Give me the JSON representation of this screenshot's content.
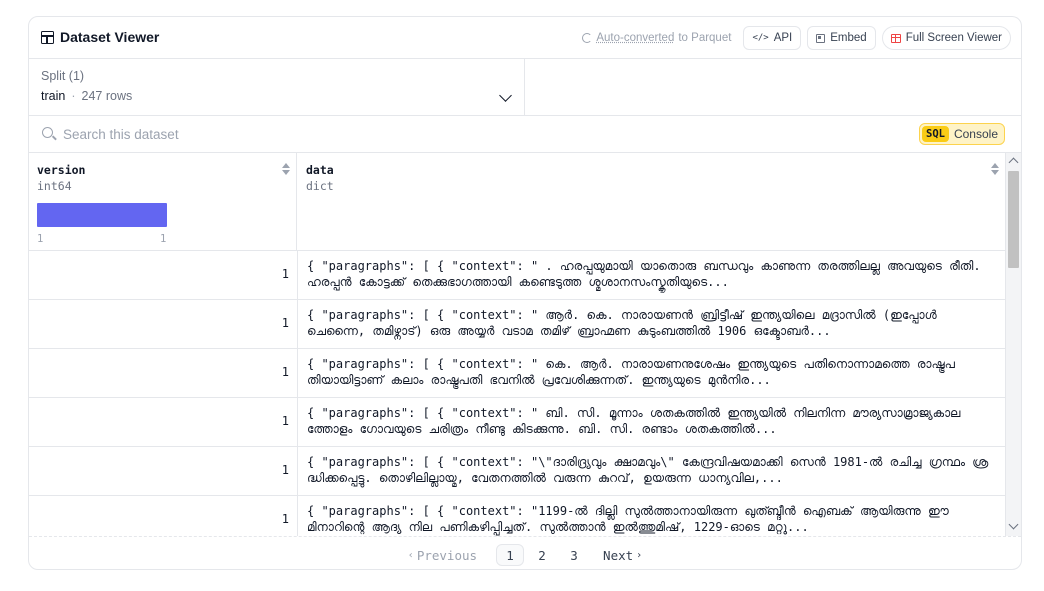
{
  "header": {
    "title": "Dataset Viewer",
    "auto_converted_link": "Auto-converted",
    "auto_converted_suffix": "to Parquet",
    "api_label": "API",
    "embed_label": "Embed",
    "full_screen_label": "Full Screen Viewer"
  },
  "split": {
    "label": "Split (1)",
    "name": "train",
    "separator": "·",
    "rows": "247 rows"
  },
  "search": {
    "placeholder": "Search this dataset",
    "sql_tag": "SQL",
    "sql_label": "Console"
  },
  "columns": [
    {
      "name": "version",
      "type": "int64",
      "histogram_min": "1",
      "histogram_max": "1"
    },
    {
      "name": "data",
      "type": "dict"
    }
  ],
  "rows": [
    {
      "version": "1",
      "data": "{ \"paragraphs\": [ { \"context\": \" . ഹരപ്പയുമായി യാതൊരു ബന്ധവും കാണുന്ന തരത്തിലല്ല അവയുടെ രീതി. ഹരപ്പൻ കോട്ടക്ക് തെക്കുഭാഗത്തായി കണ്ടെടുത്ത ശ്മശാനസംസ്കൃതിയുടെ..."
    },
    {
      "version": "1",
      "data": "{ \"paragraphs\": [ { \"context\": \" ആർ. കെ. നാരായണൻ ബ്രിട്ടീഷ് ഇന്ത്യയിലെ മദ്രാസിൽ (ഇപ്പോൾ ചെന്നൈ, തമിഴ്നാട്) ഒരു അയ്യർ വടാമ തമിഴ് ബ്രാഹ്മണ കുടുംബത്തിൽ 1906 ഒക്ടോബർ..."
    },
    {
      "version": "1",
      "data": "{ \"paragraphs\": [ { \"context\": \" കെ. ആർ. നാരായണനുശേഷം ഇന്ത്യയുടെ പതിനൊന്നാമത്തെ രാഷ്ട്രപതിയായിട്ടാണ് കലാം രാഷ്ട്രപതി ഭവനിൽ പ്രവേശിക്കുന്നത്. ഇന്ത്യയുടെ മുൻനിര..."
    },
    {
      "version": "1",
      "data": "{ \"paragraphs\": [ { \"context\": \" ബി. സി. മൂന്നാം ശതകത്തിൽ ഇന്ത്യയിൽ നിലനിന്ന മൗര്യസാമ്രാജ്യകാലത്തോളം ഗോവയുടെ ചരിത്രം നീണ്ടു കിടക്കുന്നു. ബി. സി. രണ്ടാം ശതകത്തിൽ..."
    },
    {
      "version": "1",
      "data": "{ \"paragraphs\": [ { \"context\": \"\\\"ദാരിദ്ര്യവും ക്ഷാമവും\\\" കേന്ദ്രവിഷയമാക്കി സെൻ 1981-ൽ രചിച്ച ഗ്രന്ഥം ശ്രദ്ധിക്കപ്പെട്ടു. തൊഴിലില്ലായ്മ, വേതനത്തിൽ വരുന്ന കുറവ്, ഉയരുന്ന ധാന്യവില,..."
    },
    {
      "version": "1",
      "data": "{ \"paragraphs\": [ { \"context\": \"1199-ൽ ദില്ലി സുൽത്താനായിരുന്ന ഖുത്ബ്ദീൻ ഐബക് ആയിരുന്നു ഈ മിനാറിന്റെ ആദ്യ നില പണികഴിപ്പിച്ചത്. സുൽത്താൻ ഇൽത്തുമിഷ്, 1229-ഓടെ മറ്റു..."
    }
  ],
  "pagination": {
    "previous": "Previous",
    "next": "Next",
    "pages": [
      "1",
      "2",
      "3"
    ],
    "current": "1"
  }
}
